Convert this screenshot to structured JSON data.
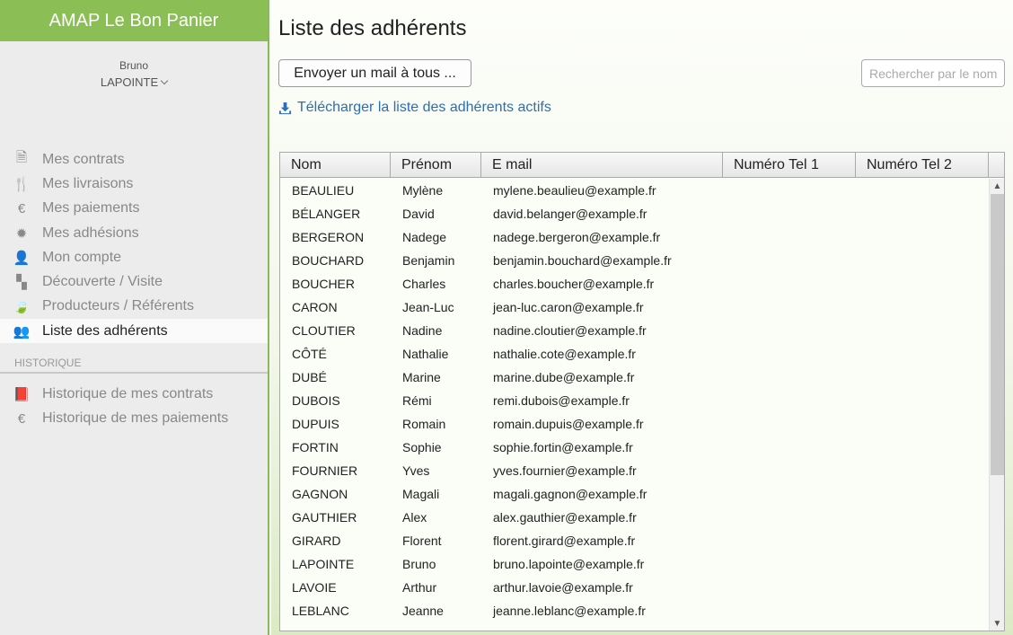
{
  "app": {
    "title": "AMAP Le Bon Panier"
  },
  "user": {
    "first_name": "Bruno",
    "last_name": "LAPOINTE"
  },
  "nav": {
    "items": [
      {
        "label": "Mes contrats",
        "icon": "document-icon",
        "glyph": "🗎"
      },
      {
        "label": "Mes livraisons",
        "icon": "cutlery-icon",
        "glyph": "🍴"
      },
      {
        "label": "Mes paiements",
        "icon": "euro-icon",
        "glyph": "€"
      },
      {
        "label": "Mes adhésions",
        "icon": "badge-icon",
        "glyph": "✹"
      },
      {
        "label": "Mon compte",
        "icon": "user-icon",
        "glyph": "👤"
      },
      {
        "label": "Découverte / Visite",
        "icon": "checker-icon",
        "glyph": "▚"
      },
      {
        "label": "Producteurs / Référents",
        "icon": "leaf-icon",
        "glyph": "🍃"
      },
      {
        "label": "Liste des adhérents",
        "icon": "users-icon",
        "glyph": "👥",
        "active": true
      }
    ],
    "history_title": "HISTORIQUE",
    "history_items": [
      {
        "label": "Historique de mes contrats",
        "icon": "book-icon",
        "glyph": "📕"
      },
      {
        "label": "Historique de mes paiements",
        "icon": "euro-icon",
        "glyph": "€"
      }
    ]
  },
  "main": {
    "title": "Liste des adhérents",
    "mail_button": "Envoyer un mail à tous ...",
    "search_placeholder": "Rechercher par le nom",
    "download_link": "Télécharger la liste des adhérents actifs"
  },
  "table": {
    "columns": [
      "Nom",
      "Prénom",
      "E mail",
      "Numéro Tel 1",
      "Numéro Tel 2"
    ],
    "rows": [
      [
        "BEAULIEU",
        "Mylène",
        "mylene.beaulieu@example.fr",
        "",
        ""
      ],
      [
        "BÉLANGER",
        "David",
        "david.belanger@example.fr",
        "",
        ""
      ],
      [
        "BERGERON",
        "Nadege",
        "nadege.bergeron@example.fr",
        "",
        ""
      ],
      [
        "BOUCHARD",
        "Benjamin",
        "benjamin.bouchard@example.fr",
        "",
        ""
      ],
      [
        "BOUCHER",
        "Charles",
        "charles.boucher@example.fr",
        "",
        ""
      ],
      [
        "CARON",
        "Jean-Luc",
        "jean-luc.caron@example.fr",
        "",
        ""
      ],
      [
        "CLOUTIER",
        "Nadine",
        "nadine.cloutier@example.fr",
        "",
        ""
      ],
      [
        "CÔTÉ",
        "Nathalie",
        "nathalie.cote@example.fr",
        "",
        ""
      ],
      [
        "DUBÉ",
        "Marine",
        "marine.dube@example.fr",
        "",
        ""
      ],
      [
        "DUBOIS",
        "Rémi",
        "remi.dubois@example.fr",
        "",
        ""
      ],
      [
        "DUPUIS",
        "Romain",
        "romain.dupuis@example.fr",
        "",
        ""
      ],
      [
        "FORTIN",
        "Sophie",
        "sophie.fortin@example.fr",
        "",
        ""
      ],
      [
        "FOURNIER",
        "Yves",
        "yves.fournier@example.fr",
        "",
        ""
      ],
      [
        "GAGNON",
        "Magali",
        "magali.gagnon@example.fr",
        "",
        ""
      ],
      [
        "GAUTHIER",
        "Alex",
        "alex.gauthier@example.fr",
        "",
        ""
      ],
      [
        "GIRARD",
        "Florent",
        "florent.girard@example.fr",
        "",
        ""
      ],
      [
        "LAPOINTE",
        "Bruno",
        "bruno.lapointe@example.fr",
        "",
        ""
      ],
      [
        "LAVOIE",
        "Arthur",
        "arthur.lavoie@example.fr",
        "",
        ""
      ],
      [
        "LEBLANC",
        "Jeanne",
        "jeanne.leblanc@example.fr",
        "",
        ""
      ]
    ]
  }
}
